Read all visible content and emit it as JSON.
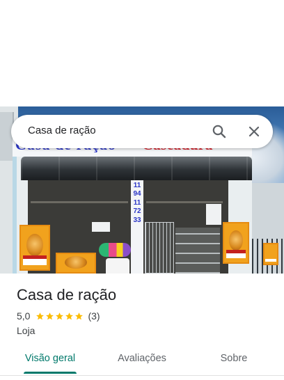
{
  "search": {
    "query": "Casa de ração",
    "search_icon": "search-icon",
    "close_icon": "close-icon"
  },
  "photo": {
    "sign_left": "Casa de ração",
    "sign_right": "Cascadura",
    "pillar_text": "1194117233"
  },
  "place": {
    "title": "Casa de ração",
    "rating": "5,0",
    "stars": 5,
    "review_count": "(3)",
    "category": "Loja"
  },
  "tabs": [
    {
      "label": "Visão geral",
      "active": true
    },
    {
      "label": "Avaliações",
      "active": false
    },
    {
      "label": "Sobre",
      "active": false
    }
  ],
  "colors": {
    "accent": "#00796b",
    "star": "#fbbc04",
    "text_primary": "#202124",
    "text_secondary": "#3c4043"
  }
}
